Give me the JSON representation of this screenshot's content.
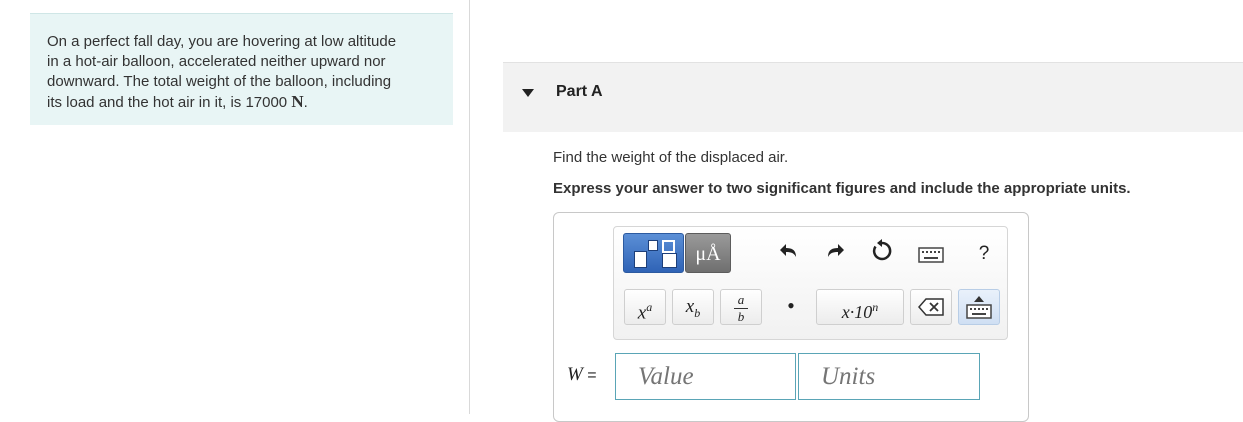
{
  "problem": {
    "lines": [
      "On a perfect fall day, you are hovering at low altitude",
      "in a hot-air balloon, accelerated neither upward nor",
      "downward. The total weight of the balloon, including",
      "its load and the hot air in it, is 17000 "
    ],
    "unit": "N",
    "end": "."
  },
  "part": {
    "title": "Part A"
  },
  "question": "Find the weight of the displaced air.",
  "instruction": "Express your answer to two significant figures and include the appropriate units.",
  "toolbar": {
    "unit_label": "μÅ",
    "help_label": "?",
    "icons": [
      "templates-icon",
      "units-icon",
      "undo-icon",
      "redo-icon",
      "reset-icon",
      "keyboard-icon",
      "help-icon"
    ],
    "keys": {
      "power_base": "x",
      "power_exp": "a",
      "sub_base": "x",
      "sub_index": "b",
      "frac_num": "a",
      "frac_den": "b",
      "dot": "•",
      "sci": "x·10",
      "sci_exp": "n"
    }
  },
  "answer": {
    "variable": "W",
    "equals": " =",
    "value_placeholder": "Value",
    "units_placeholder": "Units"
  },
  "colors": {
    "accent": "#2f63b6",
    "problem_bg": "#e8f5f5",
    "input_border": "#5aa5b6"
  }
}
